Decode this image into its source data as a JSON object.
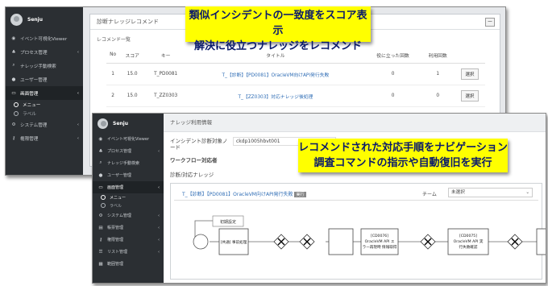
{
  "screen1": {
    "user": {
      "name": "Senju"
    },
    "menu": [
      {
        "label": "イベント可視化Viewer",
        "icon": "eye-icon"
      },
      {
        "label": "プロセス管理",
        "icon": "process-icon",
        "chevron": "‹"
      },
      {
        "label": "ナレッジ手動検索",
        "icon": "search-icon"
      },
      {
        "label": "ユーザー管理",
        "icon": "user-icon"
      },
      {
        "label": "画面管理",
        "icon": "monitor-icon",
        "chevron": "‹"
      }
    ],
    "submenu": [
      {
        "label": "メニュー"
      },
      {
        "label": "ラベル"
      }
    ],
    "menu2": [
      {
        "label": "システム管理",
        "icon": "gear-icon",
        "chevron": "‹"
      },
      {
        "label": "権限管理",
        "icon": "key-icon",
        "chevron": "‹"
      }
    ],
    "panel": {
      "title": "診断ナレッジレコメンド",
      "collapse": "－",
      "section": "レコメンド一覧",
      "columns": [
        "No",
        "スコア",
        "キー",
        "タイトル",
        "役に立った回数",
        "利用回数",
        ""
      ],
      "rows": [
        {
          "no": "1",
          "score": "15.0",
          "key": "T_PD0081",
          "title": "T_【診断】【PD0081】OracleVM向けAPI発行失敗",
          "useful": "0",
          "used": "1",
          "action": "選択"
        },
        {
          "no": "2",
          "score": "15.0",
          "key": "T_ZZ0303",
          "title": "T_【ZZ0303】対応ナレッジ後処理",
          "useful": "0",
          "used": "0",
          "action": "選択"
        }
      ]
    }
  },
  "callout1": {
    "line1": "類似インシデントの一致度をスコア表示",
    "line2": "解決に役立つナレッジをレコメンド"
  },
  "callout2": {
    "line1": "レコメンドされた対応手順をナビゲーション",
    "line2": "調査コマンドの指示や自動復旧を実行"
  },
  "screen2": {
    "user": {
      "name": "Senju"
    },
    "menu": [
      {
        "label": "イベント可視化Viewer",
        "icon": "eye-icon"
      },
      {
        "label": "プロセス管理",
        "icon": "process-icon",
        "chevron": "‹"
      },
      {
        "label": "ナレッジ手動検索",
        "icon": "search-icon"
      },
      {
        "label": "ユーザー管理",
        "icon": "user-icon"
      },
      {
        "label": "画面管理",
        "icon": "monitor-icon",
        "chevron": "‹"
      }
    ],
    "submenu": [
      {
        "label": "メニュー"
      },
      {
        "label": "ラベル"
      }
    ],
    "menu2": [
      {
        "label": "システム管理",
        "icon": "gear-icon",
        "chevron": "‹"
      },
      {
        "label": "帳票管理",
        "icon": "report-icon",
        "chevron": "‹"
      },
      {
        "label": "権限管理",
        "icon": "key-icon",
        "chevron": "‹"
      },
      {
        "label": "リスト管理",
        "icon": "list-icon",
        "chevron": "‹"
      },
      {
        "label": "範囲管理",
        "icon": "grid-icon"
      }
    ],
    "panel": {
      "title": "ナレッジ利用情報",
      "target_label": "インシデント診断対象ノード",
      "target_value": "ckdp1005hbvt001",
      "operator_label": "ワークフロー対応者",
      "knowledge_label": "診断/対応ナレッジ",
      "flow_title": "T_【診断】【PD0081】OracleVM向けAPI発行失敗",
      "flow_tag": "実行",
      "team_label": "チーム",
      "team_value": "未選択",
      "nodes": {
        "init": "初期設定",
        "n1": "[共通] 事前処理",
        "n2a": "[CD0076]",
        "n2b": "OracleVM API エ",
        "n2c": "ラー再現時 情報取得",
        "n3a": "[CD0075]",
        "n3b": "OracleVM API 実",
        "n3c": "行失敗確認"
      }
    }
  }
}
